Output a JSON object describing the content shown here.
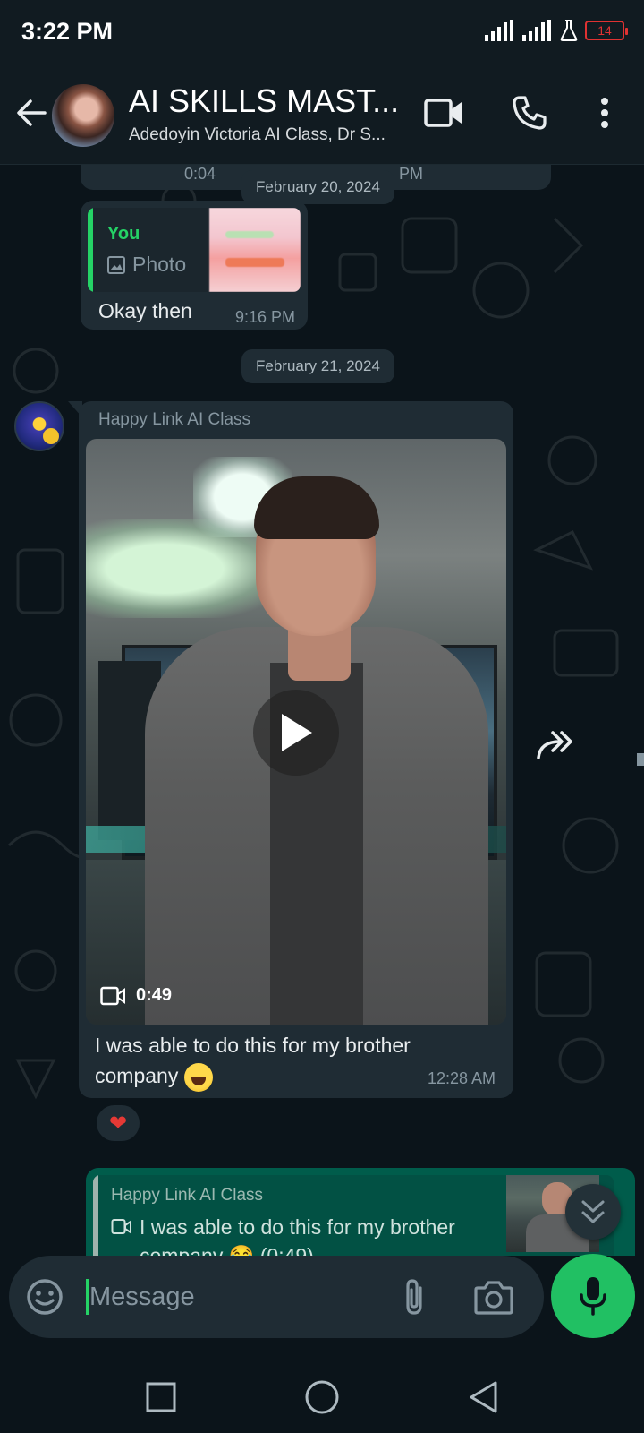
{
  "status_bar": {
    "time": "3:22 PM",
    "battery": "14",
    "icons": [
      "signal-icon",
      "signal-icon",
      "flask-icon",
      "battery-icon"
    ]
  },
  "header": {
    "title": "AI SKILLS MAST...",
    "subtitle": "Adedoyin Victoria AI Class, Dr S...",
    "icons": [
      "back-arrow-icon",
      "video-call-icon",
      "phone-icon",
      "more-vert-icon"
    ]
  },
  "messages": {
    "previous": {
      "time": "0:04",
      "time_partial": "PM"
    },
    "date_1": "February 20, 2024",
    "reply": {
      "quote_author": "You",
      "quote_type": "Photo",
      "text": "Okay then",
      "time": "9:16 PM"
    },
    "date_2": "February 21, 2024",
    "video": {
      "sender": "Happy Link AI Class",
      "duration": "0:49",
      "caption": "I was able to do this for my brother company",
      "time": "12:28 AM",
      "reaction": "❤"
    },
    "outgoing_reply": {
      "quote_sender": "Happy Link AI Class",
      "quote_text": "I was able to do this for my brother company 😂 (0:49)"
    }
  },
  "input": {
    "placeholder": "Message"
  },
  "nav": [
    "square-nav-icon",
    "circle-nav-icon",
    "back-triangle-icon"
  ],
  "colors": {
    "accent": "#25d366",
    "mic_button": "#21c063",
    "outgoing_bubble": "#005c4b",
    "incoming_bubble": "#1f2c34",
    "background": "#0b141a"
  }
}
